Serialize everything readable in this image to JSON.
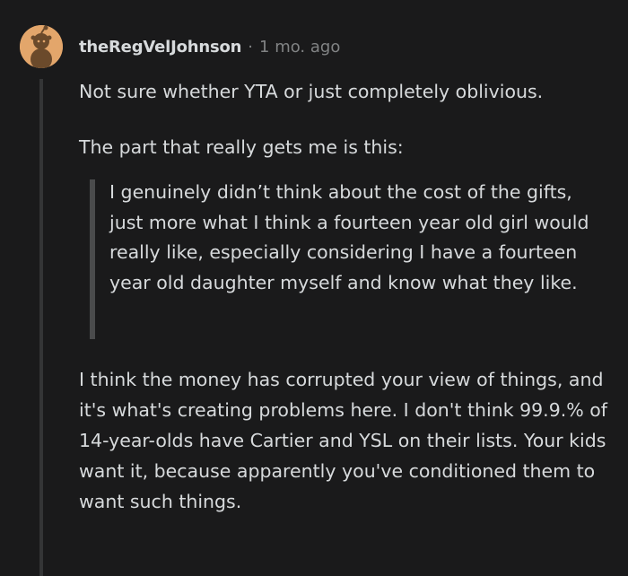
{
  "comment": {
    "author": "theRegVelJohnson",
    "separator": "·",
    "time_ago": "1 mo. ago",
    "paragraph_1": "Not sure whether YTA or just completely oblivious.",
    "paragraph_2": "The part that really gets me is this:",
    "blockquote": "I genuinely didn’t think about the cost of the gifts, just more what I think a fourteen year old girl would really like, especially considering I have a fourteen year old daughter myself and know what they like.",
    "paragraph_3": "I think the money has corrupted your view of things, and it's what's creating problems here. I don't think 99.9.% of 14-year-olds have Cartier and YSL on their lists. Your kids want it, because apparently you've conditioned them to want such things."
  },
  "colors": {
    "background": "#1a1a1b",
    "text": "#d7dadc",
    "muted": "#818384",
    "avatar": "#e3a66b",
    "thread_line": "#343536",
    "quote_bar": "#4a4b4c"
  },
  "icons": {
    "avatar": "snoo-avatar-icon"
  }
}
